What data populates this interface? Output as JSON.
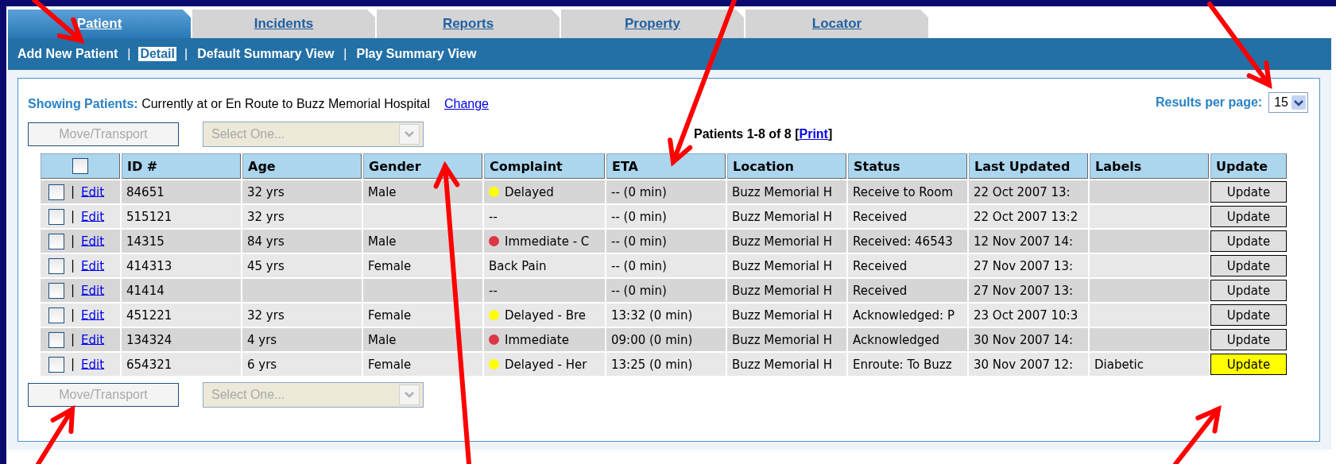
{
  "tabs": [
    {
      "label": "Patient",
      "selected": true
    },
    {
      "label": "Incidents",
      "selected": false
    },
    {
      "label": "Reports",
      "selected": false
    },
    {
      "label": "Property",
      "selected": false
    },
    {
      "label": "Locator",
      "selected": false
    }
  ],
  "subnav": [
    {
      "label": "Add New Patient",
      "selected": false
    },
    {
      "label": "Detail",
      "selected": true
    },
    {
      "label": "Default Summary View",
      "selected": false
    },
    {
      "label": "Play Summary View",
      "selected": false
    }
  ],
  "subnav_separator": "|",
  "filter": {
    "label": "Showing Patients:",
    "value": "Currently at or En Route to Buzz Memorial Hospital",
    "link": "Change"
  },
  "results_per_page": {
    "label": "Results per page:",
    "value": "15"
  },
  "toolbars": [
    {
      "button": "Move/Transport",
      "select_placeholder": "Select One...",
      "disabled": true
    },
    {
      "button": "Move/Transport",
      "select_placeholder": "Select One...",
      "disabled": true
    }
  ],
  "count": {
    "text": "Patients 1-8 of 8",
    "open": "[",
    "link": "Print",
    "close": "]"
  },
  "table": {
    "select_all_checked": false,
    "columns": [
      "ID #",
      "Age",
      "Gender",
      "Complaint",
      "ETA",
      "Location",
      "Status",
      "Last Updated",
      "Labels",
      "Update"
    ],
    "row_separator": "|",
    "rows": [
      {
        "checked": false,
        "edit": "Edit",
        "id": "84651",
        "age": "32 yrs",
        "gender": "Male",
        "complaint": {
          "text": "Delayed",
          "color": "#ffff00"
        },
        "eta": "-- (0 min)",
        "location": "Buzz Memorial H",
        "status": "Receive to Room",
        "updated": "22 Oct 2007 13:",
        "labels": "",
        "button": "Update",
        "highlighted": false
      },
      {
        "checked": false,
        "edit": "Edit",
        "id": "515121",
        "age": "32 yrs",
        "gender": "",
        "complaint": {
          "text": "--"
        },
        "eta": "-- (0 min)",
        "location": "Buzz Memorial H",
        "status": "Received",
        "updated": "22 Oct 2007 13:2",
        "labels": "",
        "button": "Update",
        "highlighted": false
      },
      {
        "checked": false,
        "edit": "Edit",
        "id": "14315",
        "age": "84 yrs",
        "gender": "Male",
        "complaint": {
          "text": "Immediate - C",
          "color": "#dc3545"
        },
        "eta": "-- (0 min)",
        "location": "Buzz Memorial H",
        "status": "Received: 46543",
        "updated": "12 Nov 2007 14:",
        "labels": "",
        "button": "Update",
        "highlighted": false
      },
      {
        "checked": false,
        "edit": "Edit",
        "id": "414313",
        "age": "45 yrs",
        "gender": "Female",
        "complaint": {
          "text": "Back Pain"
        },
        "eta": "-- (0 min)",
        "location": "Buzz Memorial H",
        "status": "Received",
        "updated": "27 Nov 2007 13:",
        "labels": "",
        "button": "Update",
        "highlighted": false
      },
      {
        "checked": false,
        "edit": "Edit",
        "id": "41414",
        "age": "",
        "gender": "",
        "complaint": {
          "text": "--"
        },
        "eta": "-- (0 min)",
        "location": "Buzz Memorial H",
        "status": "Received",
        "updated": "27 Nov 2007 13:",
        "labels": "",
        "button": "Update",
        "highlighted": false
      },
      {
        "checked": false,
        "edit": "Edit",
        "id": "451221",
        "age": "32 yrs",
        "gender": "Female",
        "complaint": {
          "text": "Delayed - Bre",
          "color": "#ffff00"
        },
        "eta": "13:32 (0 min)",
        "location": "Buzz Memorial H",
        "status": "Acknowledged: P",
        "updated": "23 Oct 2007 10:3",
        "labels": "",
        "button": "Update",
        "highlighted": false
      },
      {
        "checked": false,
        "edit": "Edit",
        "id": "134324",
        "age": "4 yrs",
        "gender": "Male",
        "complaint": {
          "text": "Immediate",
          "color": "#dc3545"
        },
        "eta": "09:00 (0 min)",
        "location": "Buzz Memorial H",
        "status": "Acknowledged",
        "updated": "30 Nov 2007 14:",
        "labels": "",
        "button": "Update",
        "highlighted": false
      },
      {
        "checked": false,
        "edit": "Edit",
        "id": "654321",
        "age": "6 yrs",
        "gender": "Female",
        "complaint": {
          "text": "Delayed - Her",
          "color": "#ffff00"
        },
        "eta": "13:25 (0 min)",
        "location": "Buzz Memorial H",
        "status": "Enroute: To Buzz",
        "updated": "30 Nov 2007 12:",
        "labels": "Diabetic",
        "button": "Update",
        "highlighted": true
      }
    ]
  }
}
